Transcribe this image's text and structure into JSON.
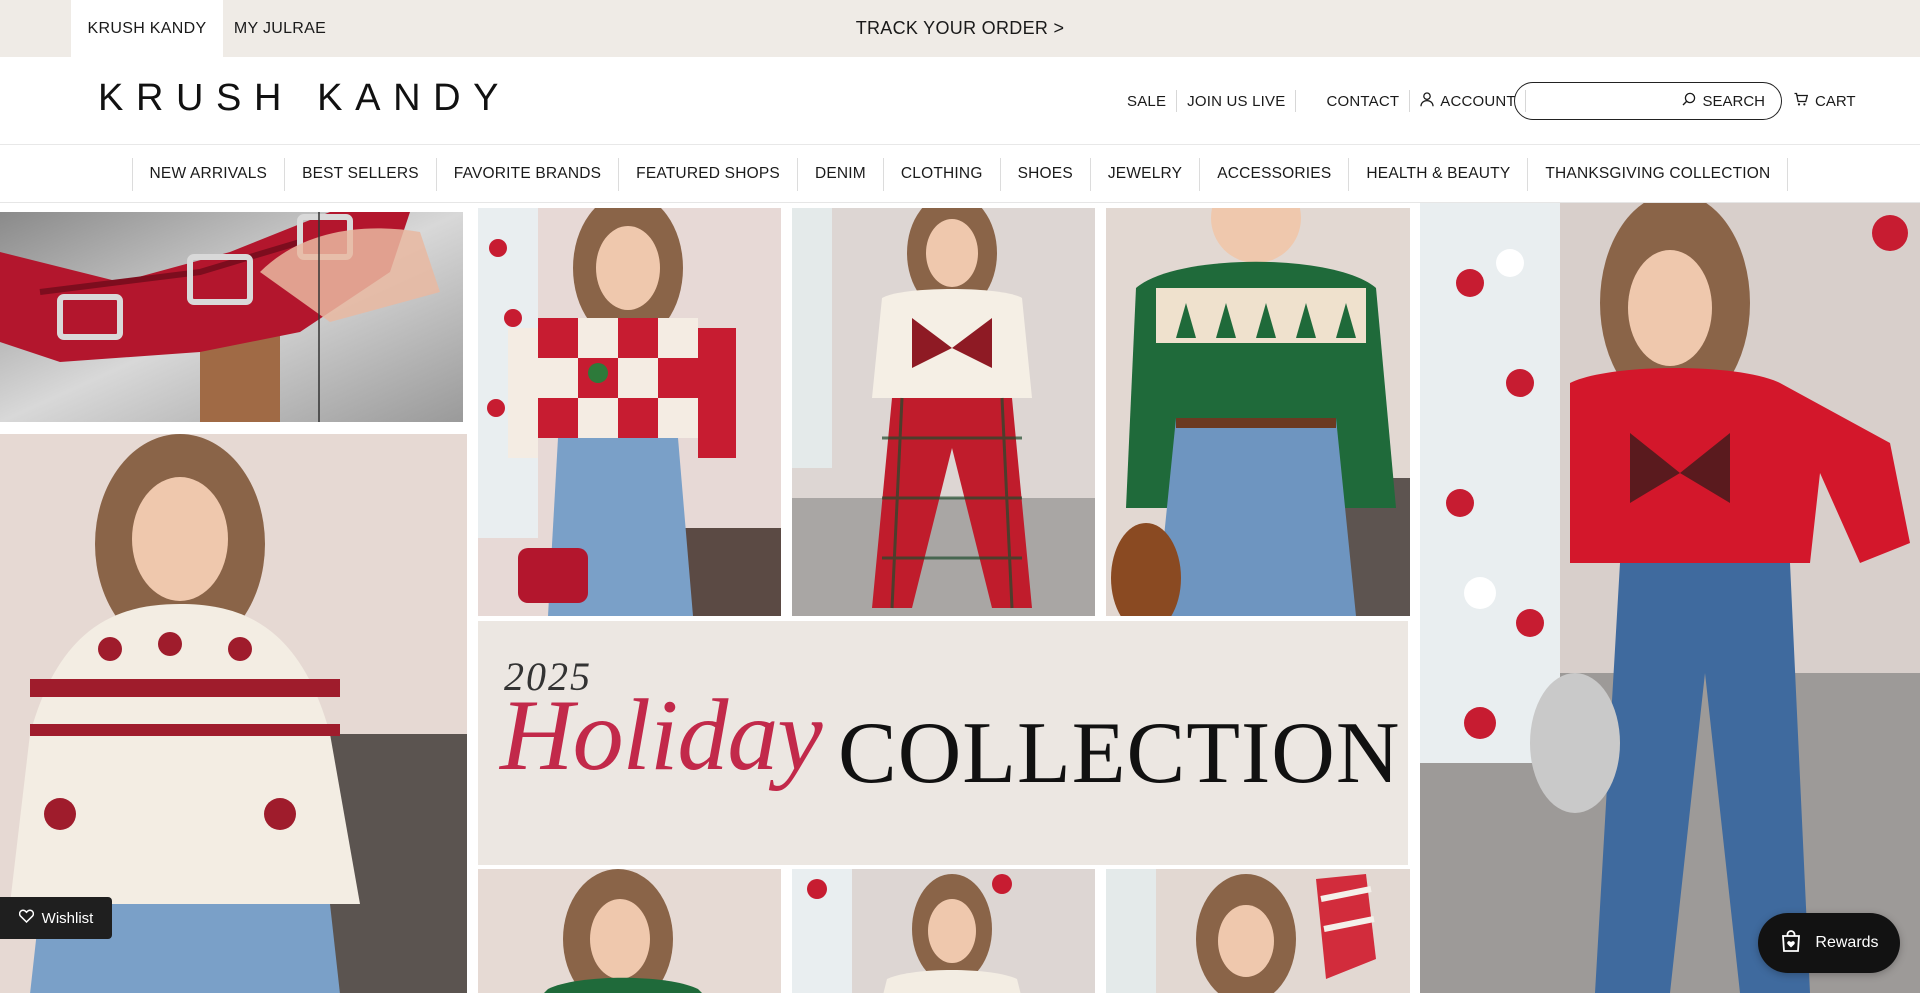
{
  "colors": {
    "topbar_bg": "#efebe6",
    "holiday_script": "#c2294a",
    "holiday_bg": "#ece7e2",
    "widget_bg": "#121212"
  },
  "topbar": {
    "store_tabs": [
      {
        "label": "KRUSH KANDY",
        "active": true
      },
      {
        "label": "MY JULRAE",
        "active": false
      }
    ],
    "announcement": "TRACK YOUR ORDER >"
  },
  "header": {
    "logo": "KRUSH KANDY",
    "links": {
      "sale": "SALE",
      "join_live": "JOIN US LIVE",
      "contact": "CONTACT",
      "account": "ACCOUNT"
    },
    "search": {
      "placeholder": "",
      "button_label": "SEARCH"
    },
    "cart_label": "CART",
    "icons": {
      "account": "user-icon",
      "search": "search-icon",
      "cart": "cart-icon"
    }
  },
  "nav": {
    "items": [
      "NEW ARRIVALS",
      "BEST SELLERS",
      "FAVORITE BRANDS",
      "FEATURED SHOPS",
      "DENIM",
      "CLOTHING",
      "SHOES",
      "JEWELRY",
      "ACCESSORIES",
      "HEALTH & BEAUTY",
      "THANKSGIVING COLLECTION"
    ]
  },
  "hero": {
    "banner": {
      "year": "2025",
      "script": "Holiday",
      "headline": "COLLECTION"
    },
    "lifestyle_tiles": [
      "red buckle heels on sequins",
      "red checkered strawberry sweater",
      "bow sweater with plaid pants",
      "green tree fair isle sweater",
      "red bow sweater with wide jeans",
      "cream snowflake fair isle sweater",
      "green sweater",
      "Tis the Season sweatshirt",
      "candy cane stocking"
    ]
  },
  "widgets": {
    "wishlist_label": "Wishlist",
    "rewards_label": "Rewards",
    "icons": {
      "wishlist": "heart-icon",
      "rewards": "shopping-bag-heart-icon"
    }
  }
}
